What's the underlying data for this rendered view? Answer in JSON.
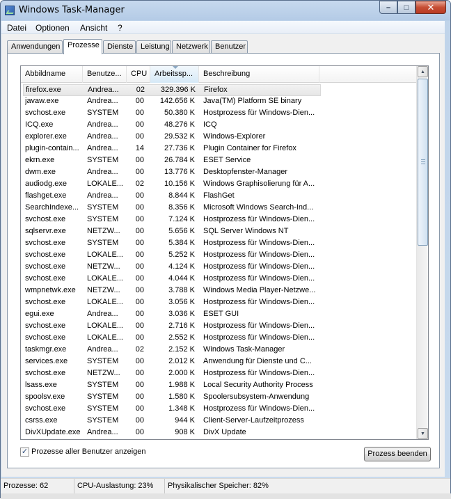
{
  "window": {
    "title": "Windows Task-Manager"
  },
  "menu": [
    "Datei",
    "Optionen",
    "Ansicht",
    "?"
  ],
  "tabs": [
    {
      "label": "Anwendungen",
      "active": false
    },
    {
      "label": "Prozesse",
      "active": true
    },
    {
      "label": "Dienste",
      "active": false
    },
    {
      "label": "Leistung",
      "active": false
    },
    {
      "label": "Netzwerk",
      "active": false
    },
    {
      "label": "Benutzer",
      "active": false
    }
  ],
  "columns": [
    "Abbildname",
    "Benutze...",
    "CPU",
    "Arbeitssp...",
    "Beschreibung"
  ],
  "processes": [
    [
      "firefox.exe",
      "Andrea...",
      "02",
      "329.396 K",
      "Firefox"
    ],
    [
      "javaw.exe",
      "Andrea...",
      "00",
      "142.656 K",
      "Java(TM) Platform SE binary"
    ],
    [
      "svchost.exe",
      "SYSTEM",
      "00",
      "50.380 K",
      "Hostprozess für Windows-Dien..."
    ],
    [
      "ICQ.exe",
      "Andrea...",
      "00",
      "48.276 K",
      "ICQ"
    ],
    [
      "explorer.exe",
      "Andrea...",
      "00",
      "29.532 K",
      "Windows-Explorer"
    ],
    [
      "plugin-contain...",
      "Andrea...",
      "14",
      "27.736 K",
      "Plugin Container for Firefox"
    ],
    [
      "ekrn.exe",
      "SYSTEM",
      "00",
      "26.784 K",
      "ESET Service"
    ],
    [
      "dwm.exe",
      "Andrea...",
      "00",
      "13.776 K",
      "Desktopfenster-Manager"
    ],
    [
      "audiodg.exe",
      "LOKALE...",
      "02",
      "10.156 K",
      "Windows Graphisolierung für A..."
    ],
    [
      "flashget.exe",
      "Andrea...",
      "00",
      "8.844 K",
      "FlashGet"
    ],
    [
      "SearchIndexe...",
      "SYSTEM",
      "00",
      "8.356 K",
      "Microsoft Windows Search-Ind..."
    ],
    [
      "svchost.exe",
      "SYSTEM",
      "00",
      "7.124 K",
      "Hostprozess für Windows-Dien..."
    ],
    [
      "sqlservr.exe",
      "NETZW...",
      "00",
      "5.656 K",
      "SQL Server Windows NT"
    ],
    [
      "svchost.exe",
      "SYSTEM",
      "00",
      "5.384 K",
      "Hostprozess für Windows-Dien..."
    ],
    [
      "svchost.exe",
      "LOKALE...",
      "00",
      "5.252 K",
      "Hostprozess für Windows-Dien..."
    ],
    [
      "svchost.exe",
      "NETZW...",
      "00",
      "4.124 K",
      "Hostprozess für Windows-Dien..."
    ],
    [
      "svchost.exe",
      "LOKALE...",
      "00",
      "4.044 K",
      "Hostprozess für Windows-Dien..."
    ],
    [
      "wmpnetwk.exe",
      "NETZW...",
      "00",
      "3.788 K",
      "Windows Media Player-Netzwe..."
    ],
    [
      "svchost.exe",
      "LOKALE...",
      "00",
      "3.056 K",
      "Hostprozess für Windows-Dien..."
    ],
    [
      "egui.exe",
      "Andrea...",
      "00",
      "3.036 K",
      "ESET GUI"
    ],
    [
      "svchost.exe",
      "LOKALE...",
      "00",
      "2.716 K",
      "Hostprozess für Windows-Dien..."
    ],
    [
      "svchost.exe",
      "LOKALE...",
      "00",
      "2.552 K",
      "Hostprozess für Windows-Dien..."
    ],
    [
      "taskmgr.exe",
      "Andrea...",
      "02",
      "2.152 K",
      "Windows Task-Manager"
    ],
    [
      "services.exe",
      "SYSTEM",
      "00",
      "2.012 K",
      "Anwendung für Dienste und C..."
    ],
    [
      "svchost.exe",
      "NETZW...",
      "00",
      "2.000 K",
      "Hostprozess für Windows-Dien..."
    ],
    [
      "lsass.exe",
      "SYSTEM",
      "00",
      "1.988 K",
      "Local Security Authority Process"
    ],
    [
      "spoolsv.exe",
      "SYSTEM",
      "00",
      "1.580 K",
      "Spoolersubsystem-Anwendung"
    ],
    [
      "svchost.exe",
      "SYSTEM",
      "00",
      "1.348 K",
      "Hostprozess für Windows-Dien..."
    ],
    [
      "csrss.exe",
      "SYSTEM",
      "00",
      "944 K",
      "Client-Server-Laufzeitprozess"
    ],
    [
      "DivXUpdate.exe",
      "Andrea...",
      "00",
      "908 K",
      "DivX Update"
    ]
  ],
  "show_all_users": {
    "label": "Prozesse aller Benutzer anzeigen",
    "checked": true,
    "mark": "✓"
  },
  "end_process_label": "Prozess beenden",
  "status": {
    "processes": "Prozesse: 62",
    "cpu": "CPU-Auslastung: 23%",
    "memory": "Physikalischer Speicher: 82%"
  },
  "caption": {
    "minimize": "–",
    "maximize": "□",
    "close": "✕"
  },
  "scroll": {
    "up": "▲",
    "down": "▼"
  }
}
